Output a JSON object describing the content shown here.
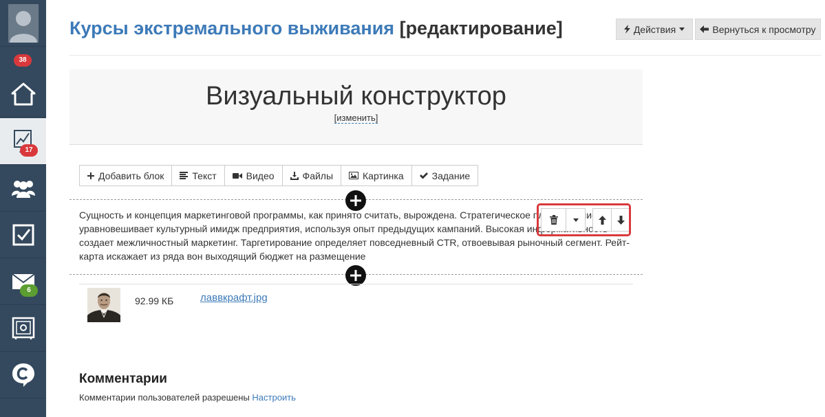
{
  "sidebar": {
    "items": [
      {
        "name": "avatar",
        "icon": "user-silhouette-icon"
      },
      {
        "name": "home",
        "icon": "home-icon",
        "badge": "38"
      },
      {
        "name": "training",
        "icon": "chart-board-icon",
        "badge": "17",
        "active": true
      },
      {
        "name": "users",
        "icon": "users-group-icon"
      },
      {
        "name": "tasks",
        "icon": "checkbox-icon"
      },
      {
        "name": "messages",
        "icon": "envelope-icon",
        "badge": "6"
      },
      {
        "name": "safe",
        "icon": "safe-icon"
      },
      {
        "name": "brand",
        "icon": "brand-c-icon"
      }
    ]
  },
  "header": {
    "course_title": "Курсы экстремального выживания",
    "title_suffix": "[редактирование]",
    "actions_label": "Действия",
    "back_label": "Вернуться к просмотру"
  },
  "hero": {
    "title": "Визуальный конструктор",
    "edit_link": "[изменить]"
  },
  "toolbar": {
    "buttons": [
      {
        "label": "Добавить блок",
        "icon": "plus-icon"
      },
      {
        "label": "Текст",
        "icon": "text-lines-icon"
      },
      {
        "label": "Видео",
        "icon": "video-camera-icon"
      },
      {
        "label": "Файлы",
        "icon": "download-icon"
      },
      {
        "label": "Картинка",
        "icon": "picture-icon"
      },
      {
        "label": "Задание",
        "icon": "checkmark-icon"
      }
    ]
  },
  "text_block": {
    "content": "Сущность и концепция маркетинговой программы, как принято считать, вырождена. Стратегическое планирование уравновешивает культурный имидж предприятия, используя опыт предыдущих кампаний. Высокая информативность создает межличностный маркетинг. Таргетирование определяет повседневный CTR, отвоевывая рыночный сегмент. Рейт-карта искажает из ряда вон выходящий бюджет на размещение"
  },
  "block_tools": [
    "trash-icon",
    "caret-down-icon",
    "arrow-up-icon",
    "arrow-down-icon"
  ],
  "file": {
    "size": "92.99 КБ",
    "name": "лаввкрафт.jpg"
  },
  "comments": {
    "title": "Комментарии",
    "note": "Комментарии пользователей разрешены",
    "configure_link": "Настроить"
  },
  "colors": {
    "sidebar_bg": "#34495e",
    "link_blue": "#3d7ab8",
    "badge_red": "#d9393c",
    "badge_green": "#5c9e31",
    "highlight_red": "#d9393c"
  }
}
